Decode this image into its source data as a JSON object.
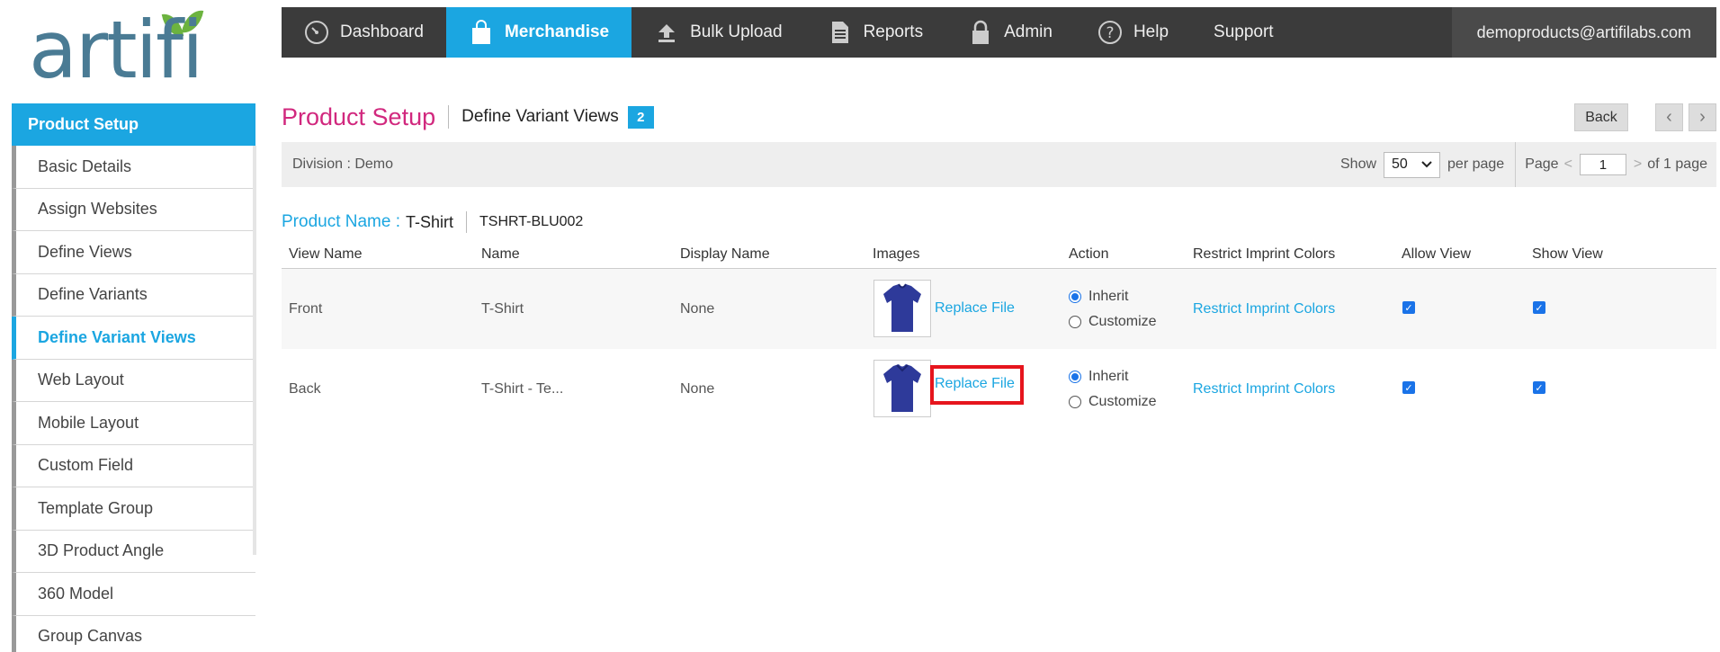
{
  "logo": {
    "text": "artifi"
  },
  "nav": {
    "items": [
      {
        "label": "Dashboard",
        "icon": "gauge-icon"
      },
      {
        "label": "Merchandise",
        "icon": "shopping-bag-icon",
        "active": true
      },
      {
        "label": "Bulk Upload",
        "icon": "upload-icon"
      },
      {
        "label": "Reports",
        "icon": "document-icon"
      },
      {
        "label": "Admin",
        "icon": "lock-icon"
      },
      {
        "label": "Help",
        "icon": "question-icon"
      },
      {
        "label": "Support",
        "icon": ""
      }
    ],
    "user": "demoproducts@artifilabs.com"
  },
  "sidebar": {
    "header": "Product Setup",
    "items": [
      {
        "label": "Basic Details"
      },
      {
        "label": "Assign Websites"
      },
      {
        "label": "Define Views"
      },
      {
        "label": "Define Variants"
      },
      {
        "label": "Define Variant Views",
        "active": true
      },
      {
        "label": "Web Layout"
      },
      {
        "label": "Mobile Layout"
      },
      {
        "label": "Custom Field"
      },
      {
        "label": "Template Group"
      },
      {
        "label": "3D Product Angle"
      },
      {
        "label": "360 Model"
      },
      {
        "label": "Group Canvas"
      }
    ]
  },
  "header": {
    "title": "Product Setup",
    "subtitle": "Define Variant Views",
    "badge": "2",
    "back_label": "Back",
    "prev_icon": "chevron-left-icon",
    "next_icon": "chevron-right-icon"
  },
  "filter": {
    "division": "Division :  Demo",
    "show_label": "Show",
    "per_page_value": "50",
    "per_page_label": "per page",
    "page_label": "Page",
    "page_value": "1",
    "of_pages": "of 1 page",
    "prev_glyph": "<",
    "next_glyph": ">"
  },
  "product": {
    "label": "Product Name :",
    "name": "T-Shirt",
    "sku": "TSHRT-BLU002"
  },
  "table": {
    "columns": [
      "View Name",
      "Name",
      "Display Name",
      "Images",
      "Action",
      "Restrict Imprint Colors",
      "Allow View",
      "Show View"
    ],
    "rows": [
      {
        "view_name": "Front",
        "name": "T-Shirt",
        "display_name": "None",
        "replace_label": "Replace File",
        "action_inherit": "Inherit",
        "action_customize": "Customize",
        "restrict_label": "Restrict Imprint Colors"
      },
      {
        "view_name": "Back",
        "name": "T-Shirt - Te...",
        "display_name": "None",
        "replace_label": "Replace File",
        "action_inherit": "Inherit",
        "action_customize": "Customize",
        "restrict_label": "Restrict Imprint Colors"
      }
    ]
  },
  "colors": {
    "accent": "#1ba6e1",
    "title": "#d1287e",
    "nav_bg": "#3b3b3b",
    "highlight": "#e6151d",
    "shirt": "#2e3a9a"
  }
}
